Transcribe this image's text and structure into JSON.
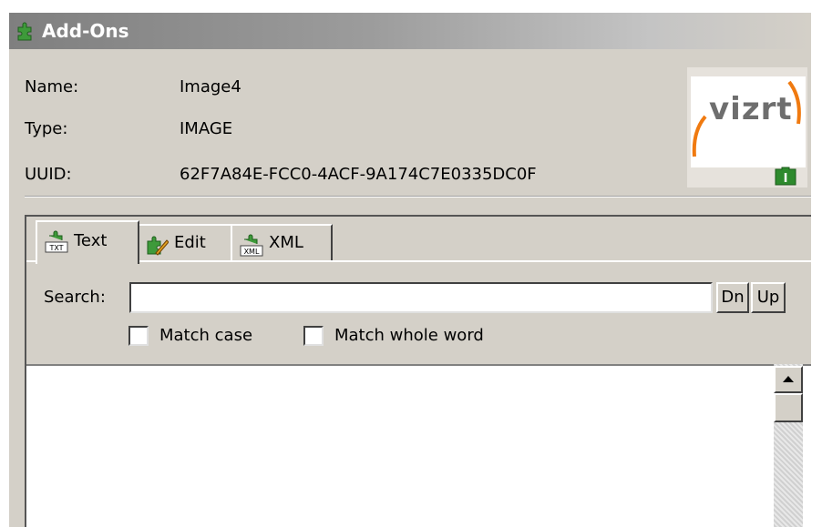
{
  "window": {
    "title": "Add-Ons",
    "icon": "puzzle-icon"
  },
  "info": [
    {
      "label": "Name:",
      "value": "Image4"
    },
    {
      "label": "Type:",
      "value": "IMAGE"
    },
    {
      "label": "UUID:",
      "value": "62F7A84E-FCC0-4ACF-9A174C7E0335DC0F"
    }
  ],
  "thumbnail": {
    "logo_text": "vizrt",
    "badge": "I",
    "accent": "#f07a10"
  },
  "tabs": [
    {
      "label": "Text",
      "icon": "puzzle-txt-icon",
      "active": true
    },
    {
      "label": "Edit",
      "icon": "puzzle-edit-icon",
      "active": false
    },
    {
      "label": "XML",
      "icon": "puzzle-xml-icon",
      "active": false
    }
  ],
  "search": {
    "label": "Search:",
    "value": "",
    "down_label": "Dn",
    "up_label": "Up"
  },
  "options": {
    "match_case": {
      "label": "Match case",
      "checked": false
    },
    "match_whole_word": {
      "label": "Match whole word",
      "checked": false
    }
  },
  "editor": {
    "content": ""
  }
}
